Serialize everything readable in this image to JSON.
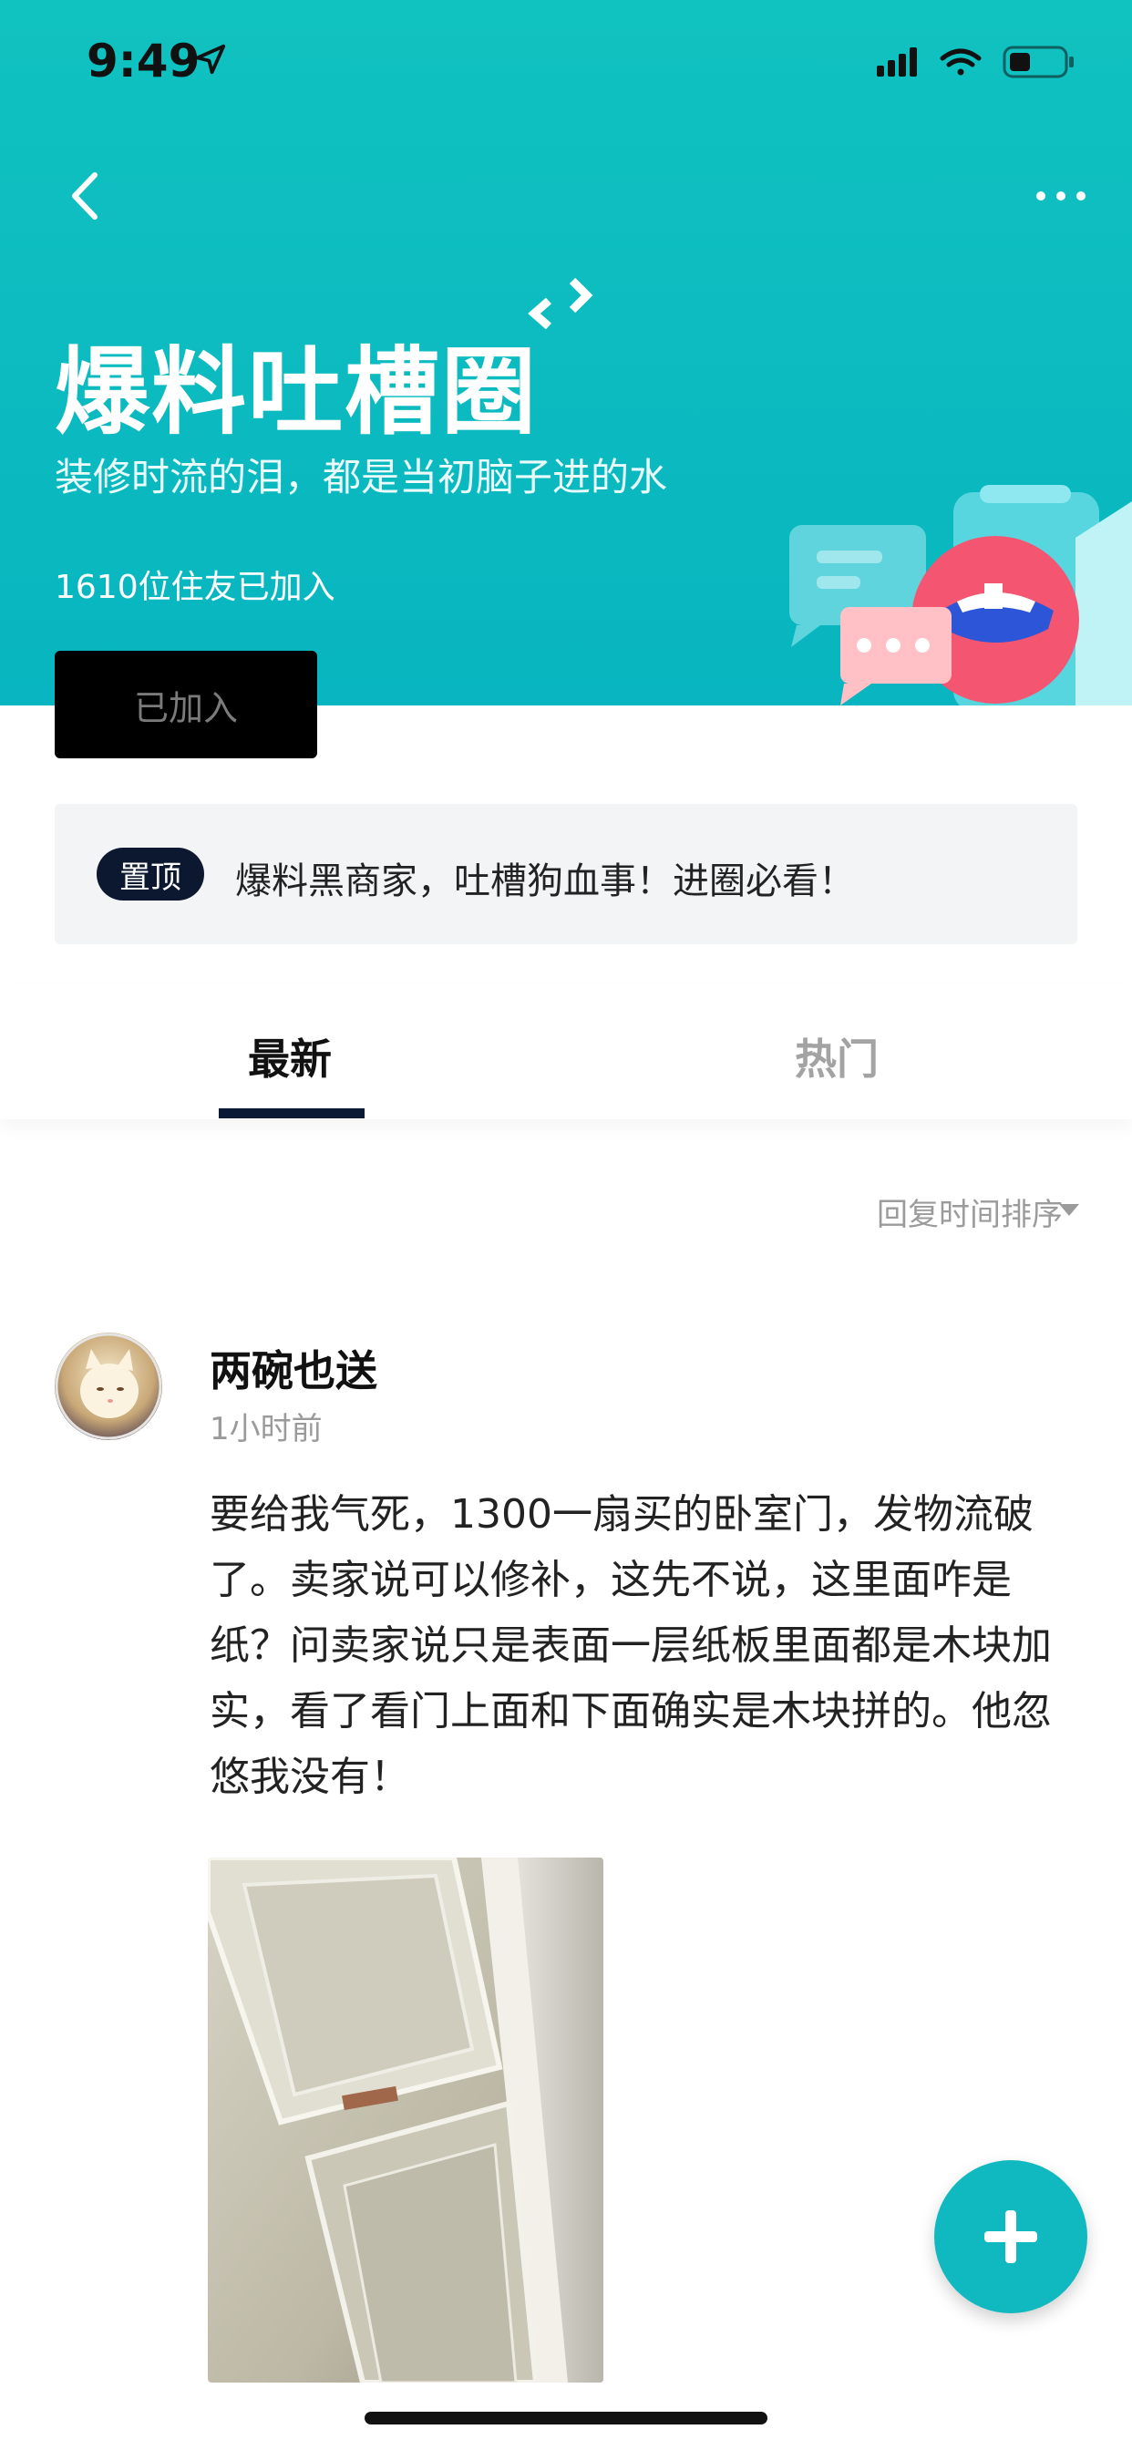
{
  "status_bar": {
    "time": "9:49"
  },
  "header": {
    "title": "爆料吐槽圈",
    "subtitle": "装修时流的泪，都是当初脑子进的水",
    "members_text": "1610位住友已加入",
    "joined_button": "已加入"
  },
  "pinned": {
    "badge": "置顶",
    "text": "爆料黑商家，吐槽狗血事！进圈必看！"
  },
  "tabs": [
    {
      "label": "最新",
      "active": true
    },
    {
      "label": "热门",
      "active": false
    }
  ],
  "sort": {
    "label": "回复时间排序"
  },
  "post": {
    "username": "两碗也送",
    "time": "1小时前",
    "text": "要给我气死，1300一扇买的卧室门，发物流破了。卖家说可以修补，这先不说，这里面咋是纸？问卖家说只是表面一层纸板里面都是木块加实，看了看门上面和下面确实是木块拼的。他忽悠我没有！"
  },
  "colors": {
    "hero": "#0fc0c0",
    "dark_button": "#000000",
    "badge": "#0c1730",
    "fab": "#10b9c0"
  }
}
